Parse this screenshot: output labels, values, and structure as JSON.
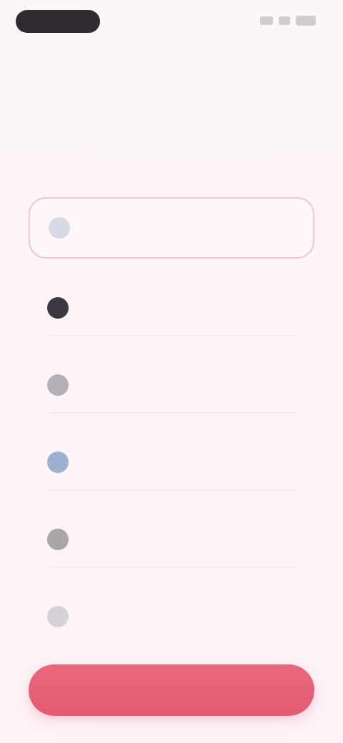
{
  "status_bar": {
    "time": "",
    "icons": [
      "signal-icon",
      "wifi-icon",
      "battery-icon"
    ]
  },
  "page": {
    "title": ""
  },
  "section": {
    "heading": "",
    "subtitle": ""
  },
  "options": [
    {
      "title": "",
      "description": "",
      "icon": "circle-icon",
      "icon_color": "#d7d9e6",
      "selected": true
    },
    {
      "title": "",
      "description": "",
      "icon": "circle-icon",
      "icon_color": "#3a3840",
      "selected": false
    },
    {
      "title": "",
      "description": "",
      "icon": "circle-icon",
      "icon_color": "#b4b0b5",
      "selected": false
    },
    {
      "title": "",
      "description": "",
      "icon": "circle-icon",
      "icon_color": "#9eb0d0",
      "selected": false
    },
    {
      "title": "",
      "description": "",
      "icon": "circle-icon",
      "icon_color": "#aaa5a6",
      "selected": false
    },
    {
      "title": "",
      "description": "",
      "icon": "circle-icon",
      "icon_color": "#d6d3d8",
      "selected": false
    }
  ],
  "cta": {
    "label": ""
  },
  "colors": {
    "accent": "#e35b73",
    "selected_border": "#f1c4cf",
    "background": "#fdf5f8"
  }
}
